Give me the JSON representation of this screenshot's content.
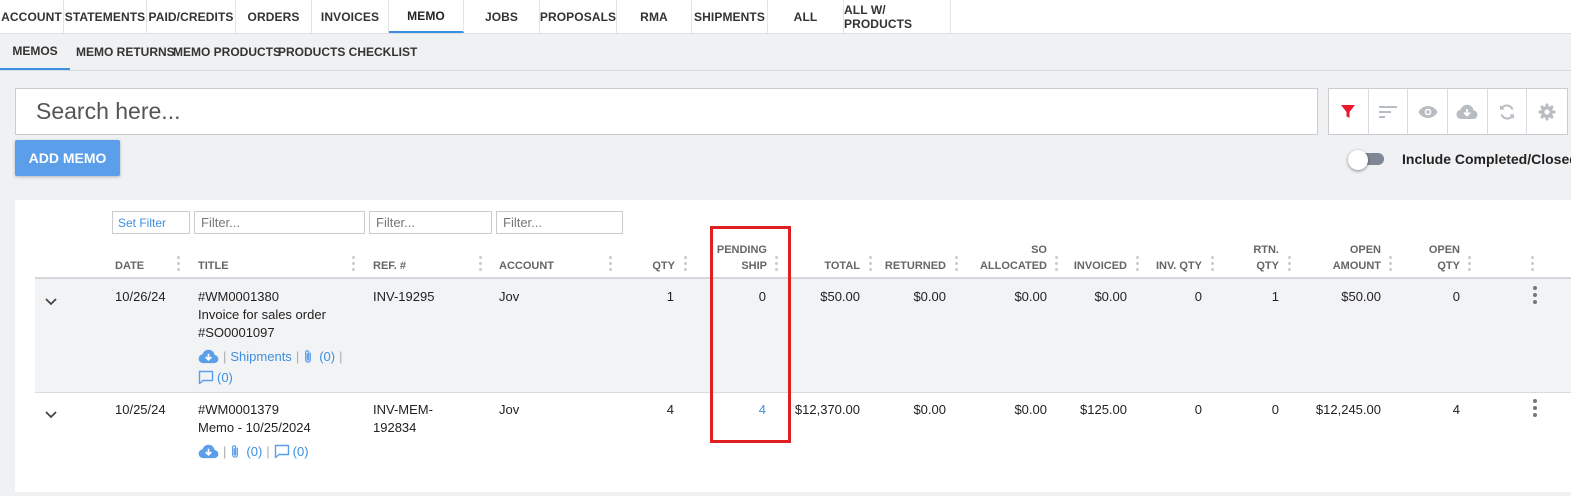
{
  "top_tabs": [
    "ACCOUNT",
    "STATEMENTS",
    "PAID/CREDITS",
    "ORDERS",
    "INVOICES",
    "MEMO",
    "JOBS",
    "PROPOSALS",
    "RMA",
    "SHIPMENTS",
    "ALL",
    "ALL W/ PRODUCTS"
  ],
  "active_top_tab": "MEMO",
  "sub_tabs": [
    "MEMOS",
    "MEMO RETURNS",
    "MEMO PRODUCTS",
    "PRODUCTS CHECKLIST"
  ],
  "active_sub_tab": "MEMOS",
  "search": {
    "placeholder": "Search here..."
  },
  "toolbar": {
    "icons": [
      "filter-icon",
      "sort-icon",
      "eye-icon",
      "cloud-download-icon",
      "sync-icon",
      "gear-icon"
    ],
    "filter_active_color": "#e8192c"
  },
  "add_button_label": "ADD MEMO",
  "toggle": {
    "label": "Include Completed/Closed",
    "on": false
  },
  "filters": {
    "set_filter_label": "Set Filter",
    "placeholder": "Filter..."
  },
  "columns": {
    "date": "DATE",
    "title": "TITLE",
    "ref": "REF. #",
    "account": "ACCOUNT",
    "qty": "QTY",
    "pending_ship_1": "PENDING",
    "pending_ship_2": "SHIP",
    "total": "TOTAL",
    "returned": "RETURNED",
    "so_allocated_1": "SO",
    "so_allocated_2": "ALLOCATED",
    "invoiced": "INVOICED",
    "inv_qty": "INV. QTY",
    "rtn_qty_1": "RTN.",
    "rtn_qty_2": "QTY",
    "open_amount_1": "OPEN",
    "open_amount_2": "AMOUNT",
    "open_qty_1": "OPEN",
    "open_qty_2": "QTY"
  },
  "rows": [
    {
      "date": "10/26/24",
      "title_1": "#WM0001380",
      "title_2": "Invoice for sales order",
      "title_3": "#SO0001097",
      "ref_1": "INV-19295",
      "account": "Jov",
      "qty": "1",
      "pending_ship": "0",
      "total": "$50.00",
      "returned": "$0.00",
      "so_allocated": "$0.00",
      "invoiced": "$0.00",
      "inv_qty": "0",
      "rtn_qty": "1",
      "open_amount": "$50.00",
      "open_qty": "0",
      "shipments_label": "Shipments",
      "attachments_count": "(0)",
      "comments_count": "(0)"
    },
    {
      "date": "10/25/24",
      "title_1": "#WM0001379",
      "title_2": "Memo - 10/25/2024",
      "ref_1": "INV-MEM-",
      "ref_2": "192834",
      "account": "Jov",
      "qty": "4",
      "pending_ship": "4",
      "total": "$12,370.00",
      "returned": "$0.00",
      "so_allocated": "$0.00",
      "invoiced": "$125.00",
      "inv_qty": "0",
      "rtn_qty": "0",
      "open_amount": "$12,245.00",
      "open_qty": "4",
      "attachments_count": "(0)",
      "comments_count": "(0)"
    }
  ],
  "colors": {
    "accent": "#3d8fe0",
    "button": "#5b9ee9",
    "highlight": "#e02020"
  }
}
